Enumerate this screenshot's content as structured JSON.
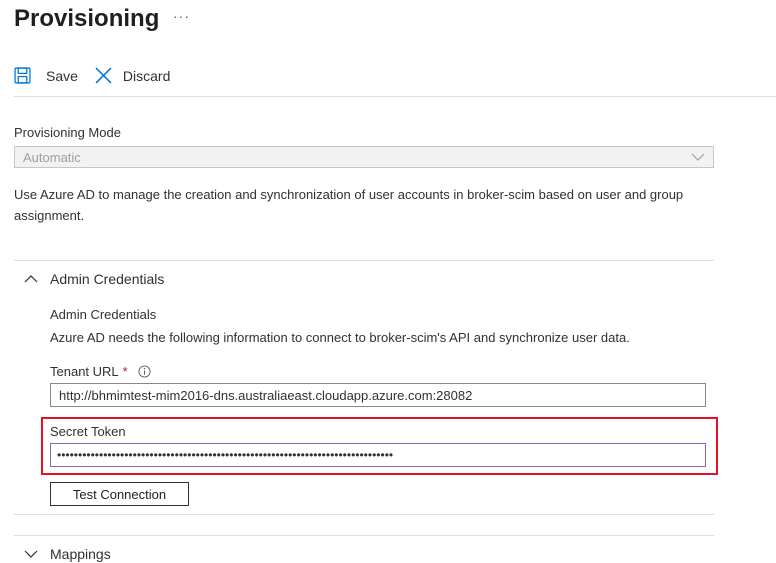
{
  "header": {
    "title": "Provisioning",
    "more": "···"
  },
  "toolbar": {
    "save_label": "Save",
    "discard_label": "Discard"
  },
  "provisioning_mode": {
    "label": "Provisioning Mode",
    "value": "Automatic"
  },
  "description": "Use Azure AD to manage the creation and synchronization of user accounts in broker-scim based on user and group assignment.",
  "admin_credentials": {
    "section_label": "Admin Credentials",
    "title": "Admin Credentials",
    "description": "Azure AD needs the following information to connect to broker-scim's API and synchronize user data.",
    "tenant_url_label": "Tenant URL",
    "required_marker": "*",
    "tenant_url_value": "http://bhmimtest-mim2016-dns.australiaeast.cloudapp.azure.com:28082",
    "secret_token_label": "Secret Token",
    "secret_token_value": "••••••••••••••••••••••••••••••••••••••••••••••••••••••••••••••••••••••••••••••••",
    "test_connection_label": "Test Connection"
  },
  "mappings": {
    "section_label": "Mappings"
  },
  "colors": {
    "accent": "#0078d4",
    "highlight": "#e81123",
    "required": "#a4262c"
  },
  "icons": {
    "save": "save-icon",
    "discard": "close-icon",
    "chevron_up": "chevron-up-icon",
    "chevron_down": "chevron-down-icon",
    "info": "info-icon"
  }
}
